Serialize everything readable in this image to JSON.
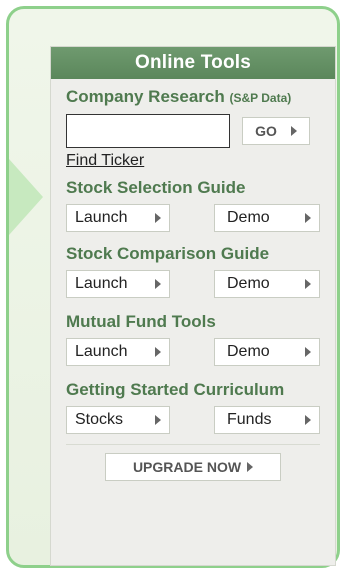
{
  "panel": {
    "title": "Online Tools"
  },
  "company_research": {
    "title": "Company Research",
    "subtitle": "(S&P Data)",
    "input_value": "",
    "go_label": "GO",
    "find_ticker_label": "Find Ticker"
  },
  "sections": [
    {
      "title": "Stock Selection Guide",
      "left_label": "Launch",
      "right_label": "Demo"
    },
    {
      "title": "Stock Comparison Guide",
      "left_label": "Launch",
      "right_label": "Demo"
    },
    {
      "title": "Mutual Fund Tools",
      "left_label": "Launch",
      "right_label": "Demo"
    },
    {
      "title": "Getting Started Curriculum",
      "left_label": "Stocks",
      "right_label": "Funds"
    }
  ],
  "upgrade": {
    "label": "UPGRADE NOW"
  },
  "colors": {
    "border_accent": "#8ed08b",
    "header_bg": "#5b875b",
    "section_title": "#4f7a4f"
  },
  "icons": {
    "button_arrow": "play-right-triangle-icon"
  }
}
